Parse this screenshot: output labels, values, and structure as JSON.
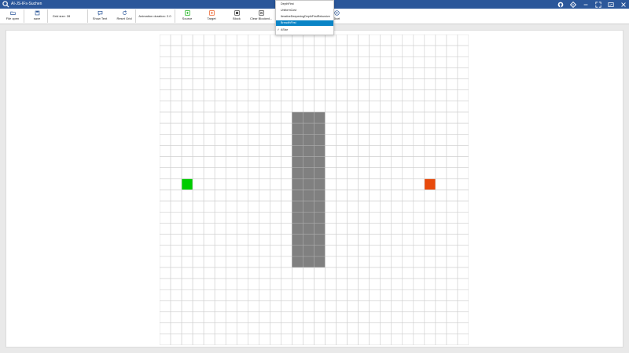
{
  "window": {
    "title": "AI-JS-IFs-Suchen"
  },
  "toolbar": {
    "file_open": "File open",
    "save": "save",
    "grid_size": "Grid size: 28",
    "show_text": "Show Text",
    "reset_grid": "Reset Grid",
    "animation_duration": "Animation duration: 2.0",
    "source": "Source",
    "target": "Target",
    "block": "Block",
    "clear_blocked": "Clear Blocked...",
    "start": "Start"
  },
  "algorithm_menu": {
    "items": [
      "DepthFirst",
      "UniformCost",
      "IterativeDeepeningDepthFirstRekursive",
      "BreadthFirst",
      "AStar"
    ],
    "highlighted": "BreadthFirst",
    "checked": "AStar"
  },
  "grid": {
    "rows": 28,
    "cols": 28,
    "source_cell": [
      13,
      2
    ],
    "target_cell": [
      13,
      24
    ],
    "blocked_rect": {
      "row_start": 7,
      "row_end": 20,
      "col_start": 12,
      "col_end": 14
    }
  },
  "colors": {
    "titlebar": "#2b579a",
    "source": "#00cc00",
    "target": "#e84a0c",
    "blocked": "#808080",
    "highlight": "#0a84c6",
    "grid_line": "#cfcfcf"
  }
}
